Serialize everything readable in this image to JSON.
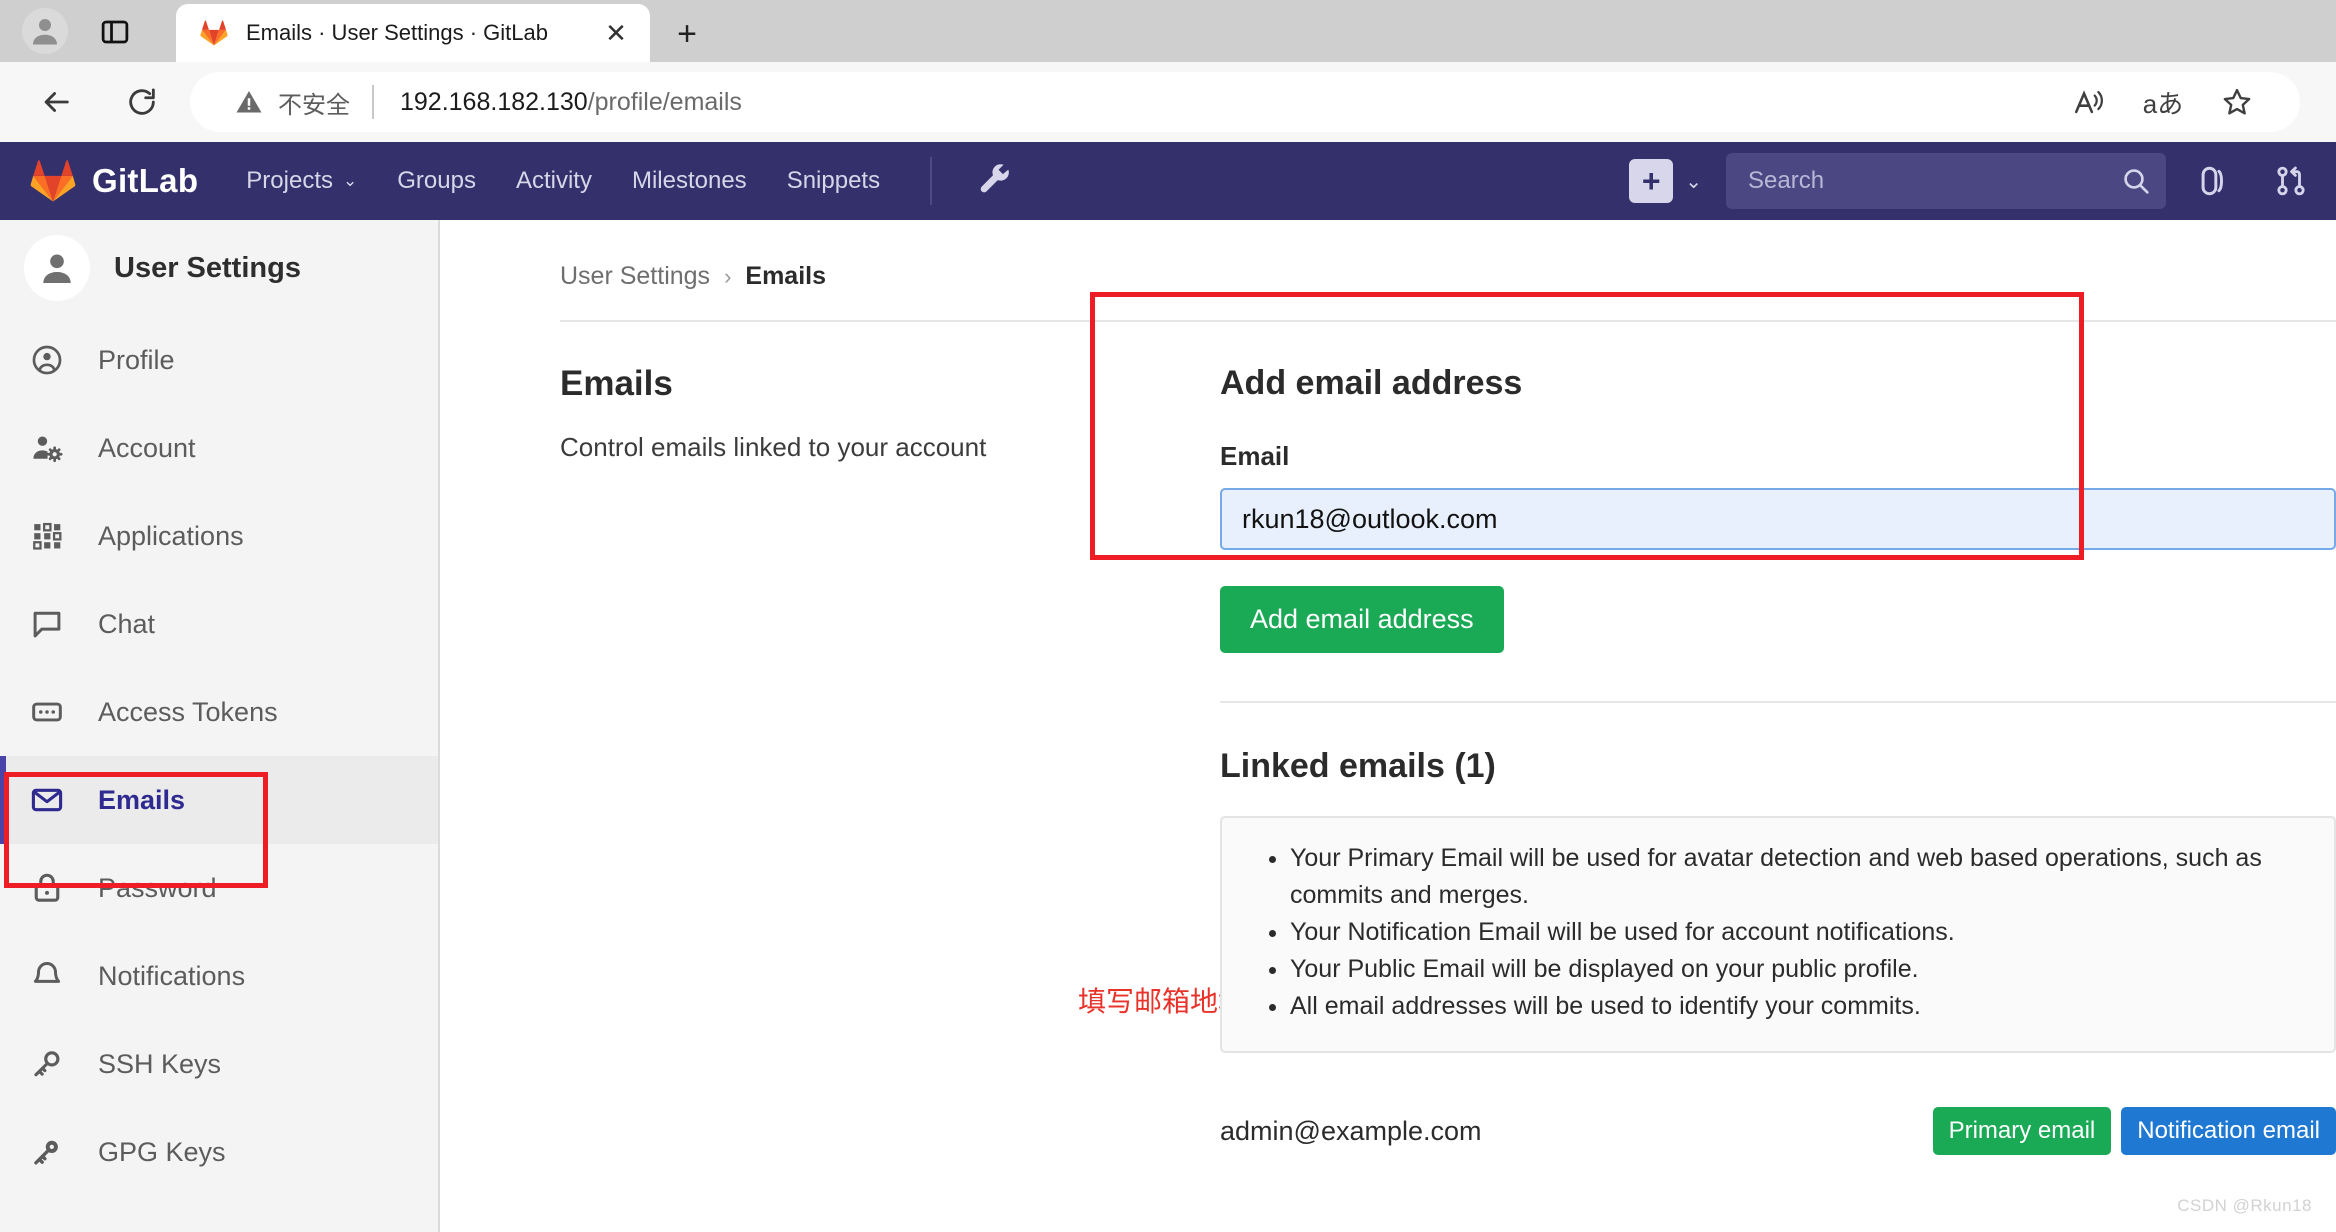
{
  "browser": {
    "profile_icon": "account-avatar-icon",
    "panel_icon": "tab-panel-icon",
    "tab": {
      "favicon": "gitlab-favicon",
      "title": "Emails · User Settings · GitLab",
      "close_label": "✕"
    },
    "new_tab_label": "+",
    "nav": {
      "back_icon": "back-arrow-icon",
      "reload_icon": "reload-icon"
    },
    "omnibox": {
      "security_icon": "warning-triangle-icon",
      "security_text": "不安全",
      "url_host": "192.168.182.130",
      "url_path": "/profile/emails",
      "actions": [
        {
          "name": "read-aloud-icon",
          "glyph": "A͓"
        },
        {
          "name": "translate-icon",
          "glyph": "aあ"
        },
        {
          "name": "favorite-star-icon",
          "glyph": "☆"
        }
      ]
    },
    "split_screen_icon": "split-screen-icon"
  },
  "gitlab_nav": {
    "logo_text": "GitLab",
    "items": [
      {
        "label": "Projects",
        "has_caret": true,
        "caret": "⌄"
      },
      {
        "label": "Groups",
        "has_caret": false
      },
      {
        "label": "Activity",
        "has_caret": false
      },
      {
        "label": "Milestones",
        "has_caret": false
      },
      {
        "label": "Snippets",
        "has_caret": false
      }
    ],
    "admin_wrench_icon": "wrench-icon",
    "plus_label": "+",
    "plus_caret": "⌄",
    "search_placeholder": "Search",
    "search_value": "",
    "issues_icon": "issues-icon",
    "merge_requests_icon": "merge-request-icon"
  },
  "sidebar": {
    "title": "User Settings",
    "avatar_icon": "user-avatar-icon",
    "items": [
      {
        "label": "Profile",
        "icon": "profile-icon",
        "active": false
      },
      {
        "label": "Account",
        "icon": "account-gear-icon",
        "active": false
      },
      {
        "label": "Applications",
        "icon": "applications-grid-icon",
        "active": false
      },
      {
        "label": "Chat",
        "icon": "chat-bubble-icon",
        "active": false
      },
      {
        "label": "Access Tokens",
        "icon": "access-token-icon",
        "active": false
      },
      {
        "label": "Emails",
        "icon": "envelope-icon",
        "active": true
      },
      {
        "label": "Password",
        "icon": "lock-icon",
        "active": false
      },
      {
        "label": "Notifications",
        "icon": "bell-icon",
        "active": false
      },
      {
        "label": "SSH Keys",
        "icon": "key-icon",
        "active": false
      },
      {
        "label": "GPG Keys",
        "icon": "key-icon",
        "active": false
      }
    ]
  },
  "breadcrumb": {
    "parent": "User Settings",
    "separator": "›",
    "current": "Emails"
  },
  "page": {
    "heading": "Emails",
    "description": "Control emails linked to your account"
  },
  "add_email": {
    "heading": "Add email address",
    "field_label": "Email",
    "field_value": "rkun18@outlook.com",
    "field_placeholder": "",
    "submit_label": "Add email address"
  },
  "linked_emails": {
    "heading": "Linked emails (1)",
    "notes": [
      "Your Primary Email will be used for avatar detection and web based operations, such as commits and merges.",
      "Your Notification Email will be used for account notifications.",
      "Your Public Email will be displayed on your public profile.",
      "All email addresses will be used to identify your commits."
    ],
    "rows": [
      {
        "address": "admin@example.com",
        "badges": [
          {
            "label": "Primary email",
            "color": "#1aaa55"
          },
          {
            "label": "Notification email",
            "color": "#1f78d1"
          }
        ]
      }
    ]
  },
  "annotations": {
    "note_text": "填写邮箱地址",
    "color": "#ee1c25"
  },
  "watermark": "CSDN @Rkun18",
  "colors": {
    "gitlab_navbar": "#33306c",
    "sidebar_bg": "#f4f4f4",
    "active_item": "#4b44a8",
    "primary_green": "#1aaa55",
    "notification_blue": "#1f78d1",
    "annotation_red": "#ee1c25"
  }
}
